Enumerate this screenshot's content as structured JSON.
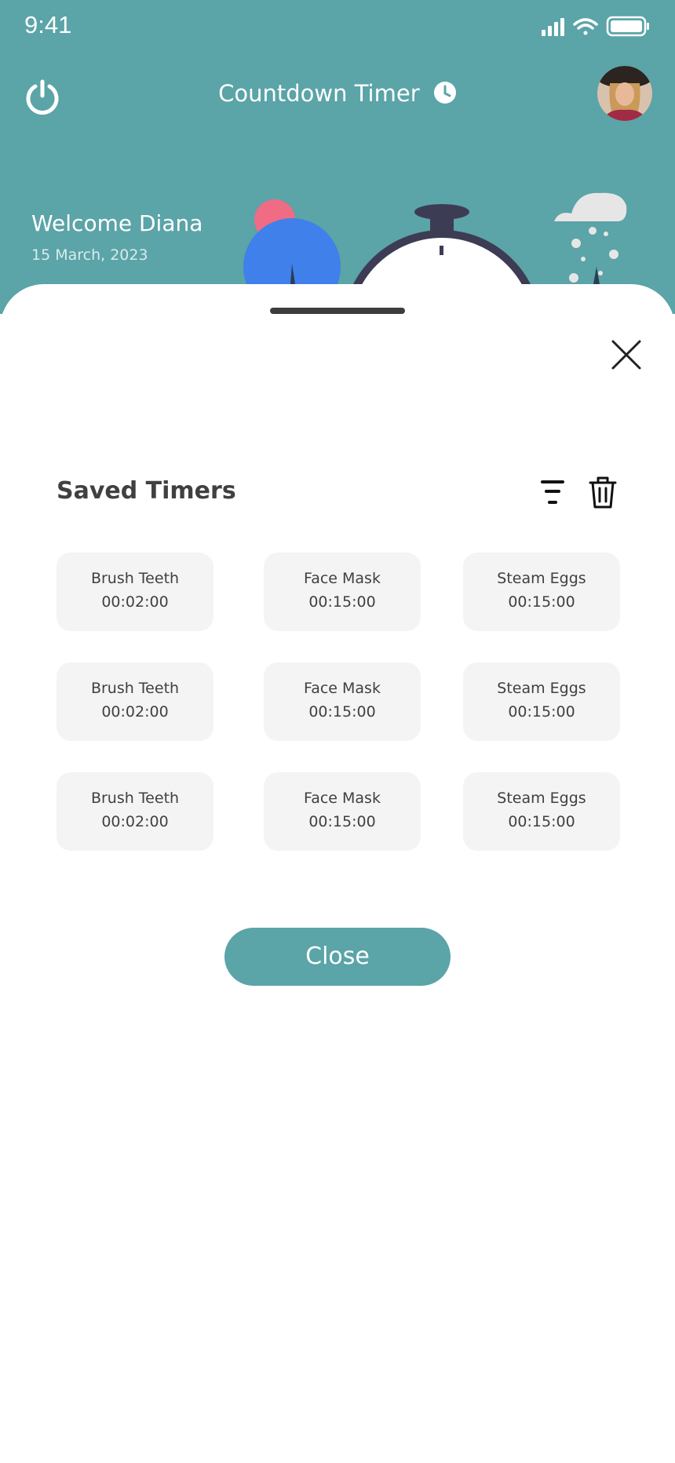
{
  "status_bar": {
    "time": "9:41"
  },
  "header": {
    "title": "Countdown Timer",
    "welcome": "Welcome Diana",
    "date": "15 March, 2023"
  },
  "sheet": {
    "title": "Saved Timers",
    "close_button": "Close",
    "timers": [
      {
        "name": "Brush Teeth",
        "time": "00:02:00"
      },
      {
        "name": "Face Mask",
        "time": "00:15:00"
      },
      {
        "name": "Steam Eggs",
        "time": "00:15:00"
      },
      {
        "name": "Brush Teeth",
        "time": "00:02:00"
      },
      {
        "name": "Face Mask",
        "time": "00:15:00"
      },
      {
        "name": "Steam Eggs",
        "time": "00:15:00"
      },
      {
        "name": "Brush Teeth",
        "time": "00:02:00"
      },
      {
        "name": "Face Mask",
        "time": "00:15:00"
      },
      {
        "name": "Steam Eggs",
        "time": "00:15:00"
      }
    ]
  },
  "colors": {
    "accent": "#5ba4a8",
    "card_bg": "#f4f4f4",
    "text_dark": "#404040"
  },
  "icons": [
    "power-icon",
    "clock-icon",
    "filter-icon",
    "trash-icon",
    "close-icon",
    "signal-icon",
    "wifi-icon",
    "battery-icon"
  ]
}
